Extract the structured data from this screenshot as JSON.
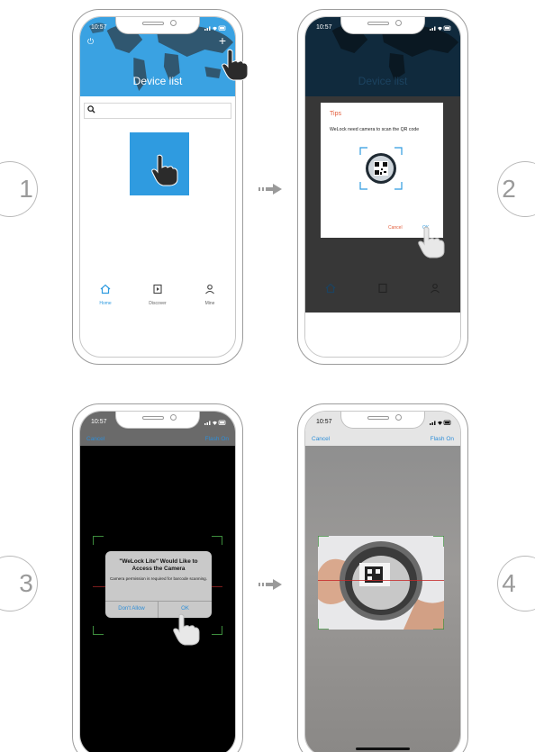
{
  "steps": {
    "s1": "1",
    "s2": "2",
    "s3": "3",
    "s4": "4"
  },
  "colors": {
    "primary_blue": "#3aa2e2",
    "tile_blue": "#2f9be0",
    "dialog_title": "#e25c3a",
    "link_blue": "#2e8ed8",
    "scan_corner_green": "#3d8c3d"
  },
  "phone1": {
    "time": "10:57",
    "title": "Device list",
    "search_icon": "search-icon",
    "tabs": [
      {
        "label": "Home",
        "icon": "home-icon"
      },
      {
        "label": "Discover",
        "icon": "discover-icon"
      },
      {
        "label": "Mine",
        "icon": "person-icon"
      }
    ]
  },
  "phone2": {
    "time": "10:57",
    "title": "Device list",
    "dialog": {
      "title": "Tips",
      "message": "WeLock need camera to scan the QR code",
      "cancel": "Cancel",
      "ok": "OK"
    }
  },
  "phone3": {
    "time": "10:57",
    "cancel": "Cancel",
    "flash": "Flash On",
    "alert": {
      "title": "\"WeLock Lite\" Would Like to Access the Camera",
      "message": "Camera permission is required for barcode scanning.",
      "deny": "Don't Allow",
      "ok": "OK"
    }
  },
  "phone4": {
    "time": "10:57",
    "cancel": "Cancel",
    "flash": "Flash On"
  }
}
